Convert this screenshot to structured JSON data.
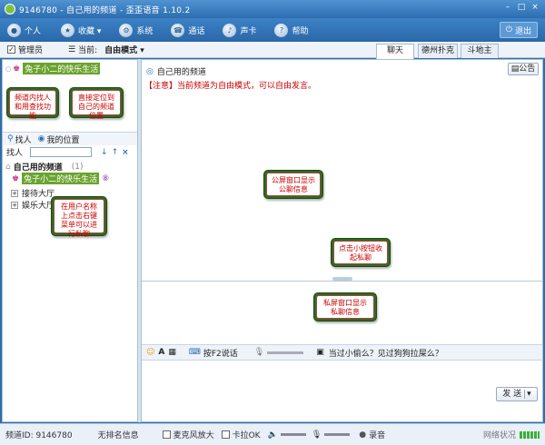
{
  "window": {
    "title": "9146780 - 自己用的频道 - 歪歪语音 1.10.2",
    "min": "–",
    "max": "□",
    "close": "×"
  },
  "menu": {
    "items": [
      {
        "label": "个人",
        "icon": "person-icon"
      },
      {
        "label": "收藏 ▾",
        "icon": "star-icon"
      },
      {
        "label": "系统",
        "icon": "system-icon"
      },
      {
        "label": "通话",
        "icon": "phone-icon"
      },
      {
        "label": "声卡",
        "icon": "speaker-icon"
      },
      {
        "label": "帮助",
        "icon": "help-icon"
      }
    ],
    "exit": "退出"
  },
  "toolbar": {
    "admin": "管理员",
    "current_label": "当前:",
    "mode": "自由模式 ▾"
  },
  "tabs": [
    "聊天",
    "德州扑克",
    "斗地主"
  ],
  "left": {
    "top_channel": "兔子小二的快乐生活",
    "find_person": "找人",
    "my_position": "我的位置",
    "search_label": "找人",
    "tree_root": "自己用的频道",
    "tree_root_count": "(1)",
    "tree_user": "兔子小二的快乐生活",
    "rooms": [
      "接待大厅",
      "娱乐大厅"
    ]
  },
  "right": {
    "channel_name": "自己用的频道",
    "announce": "公告",
    "notice": "【注意】当前频道为自由模式，可以自由发言。",
    "f2_talk": "按F2说话",
    "marquee": "当过小偷么？见过狗狗拉屎么？",
    "send": "发 送",
    "send_arrow": "▾"
  },
  "callouts": {
    "c1": "频道内找人和用查找功能",
    "c2": "直接定位到自己的频道位置",
    "c3": "在用户名称上点击右键菜单可以进行私聊",
    "c4": "公屏窗口显示公聊信息",
    "c5": "点击小按钮收起私聊",
    "c6": "私屏窗口显示私聊信息"
  },
  "status": {
    "channel_id": "频道ID: 9146780",
    "no_sign": "无排名信息",
    "mic_boost": "麦克风放大",
    "karaoke": "卡拉OK",
    "record": "录音",
    "network": "网络状况"
  }
}
